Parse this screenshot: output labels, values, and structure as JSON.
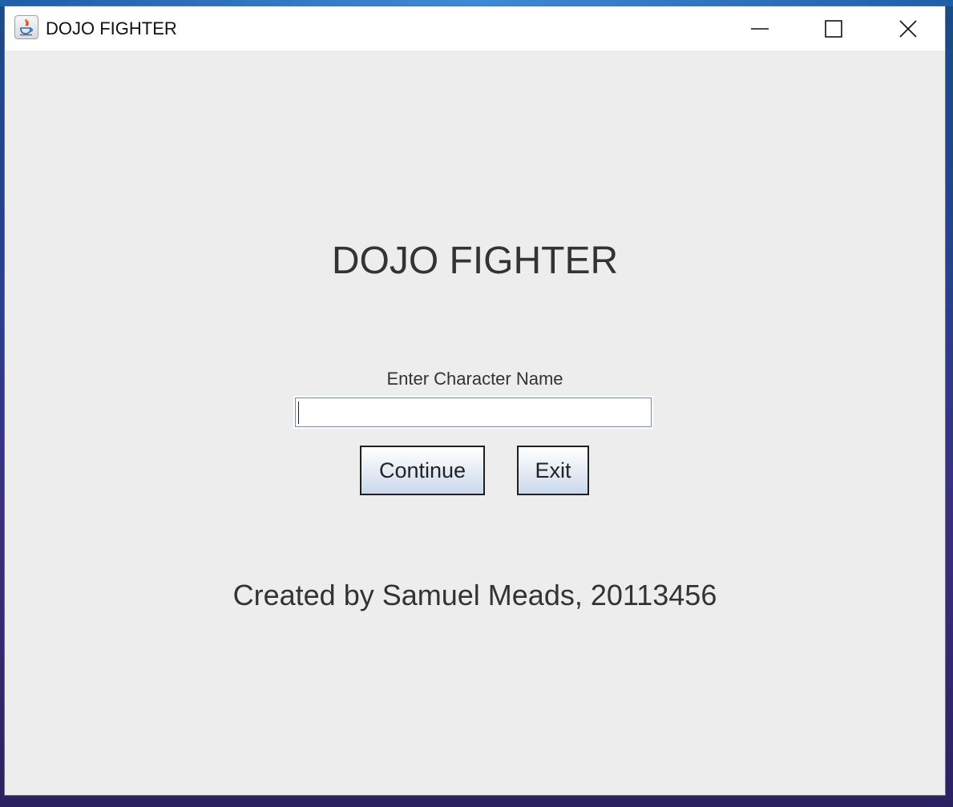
{
  "window": {
    "title": "DOJO FIGHTER",
    "icon": "java-app-icon",
    "controls": {
      "minimize_icon": "minimize-icon",
      "maximize_icon": "maximize-icon",
      "close_icon": "close-icon"
    }
  },
  "main": {
    "heading": "DOJO FIGHTER",
    "name_label": "Enter Character Name",
    "name_input": {
      "value": "",
      "placeholder": ""
    },
    "buttons": {
      "continue_label": "Continue",
      "exit_label": "Exit"
    },
    "credit": "Created by Samuel Meads, 20113456"
  },
  "colors": {
    "window_bg": "#ededed",
    "titlebar_bg": "#ffffff",
    "text": "#333333",
    "button_gradient_bottom": "#c9d9ec"
  }
}
